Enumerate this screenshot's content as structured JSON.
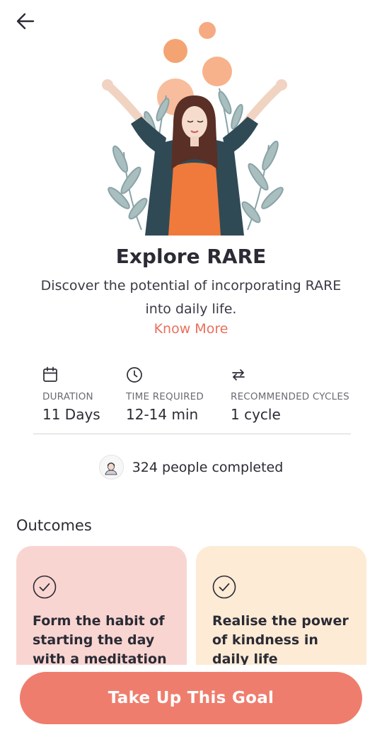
{
  "header": {
    "back_icon": "arrow-left-icon"
  },
  "hero": {
    "illustration": "woman-meditation-with-leaves"
  },
  "goal": {
    "title": "Explore RARE",
    "description": "Discover the potential of incorporating RARE into daily life.",
    "know_more": "Know More"
  },
  "stats": {
    "duration": {
      "icon": "calendar-icon",
      "label": "DURATION",
      "value": "11 Days"
    },
    "time_required": {
      "icon": "clock-icon",
      "label": "TIME REQUIRED",
      "value": "12-14 min"
    },
    "cycles": {
      "icon": "repeat-icon",
      "label": "RECOMMENDED CYCLES",
      "value": "1 cycle"
    }
  },
  "completed": {
    "text": "324 people completed"
  },
  "outcomes": {
    "title": "Outcomes",
    "items": [
      {
        "text": "Form the habit of starting the day with a meditation",
        "color": "#f9d5d1"
      },
      {
        "text": "Realise the power of kindness in daily life",
        "color": "#fdebd5"
      }
    ]
  },
  "cta": {
    "label": "Take Up This Goal",
    "color": "#ef7d6d"
  },
  "colors": {
    "accent": "#e8705d",
    "text": "#2b2b35"
  }
}
